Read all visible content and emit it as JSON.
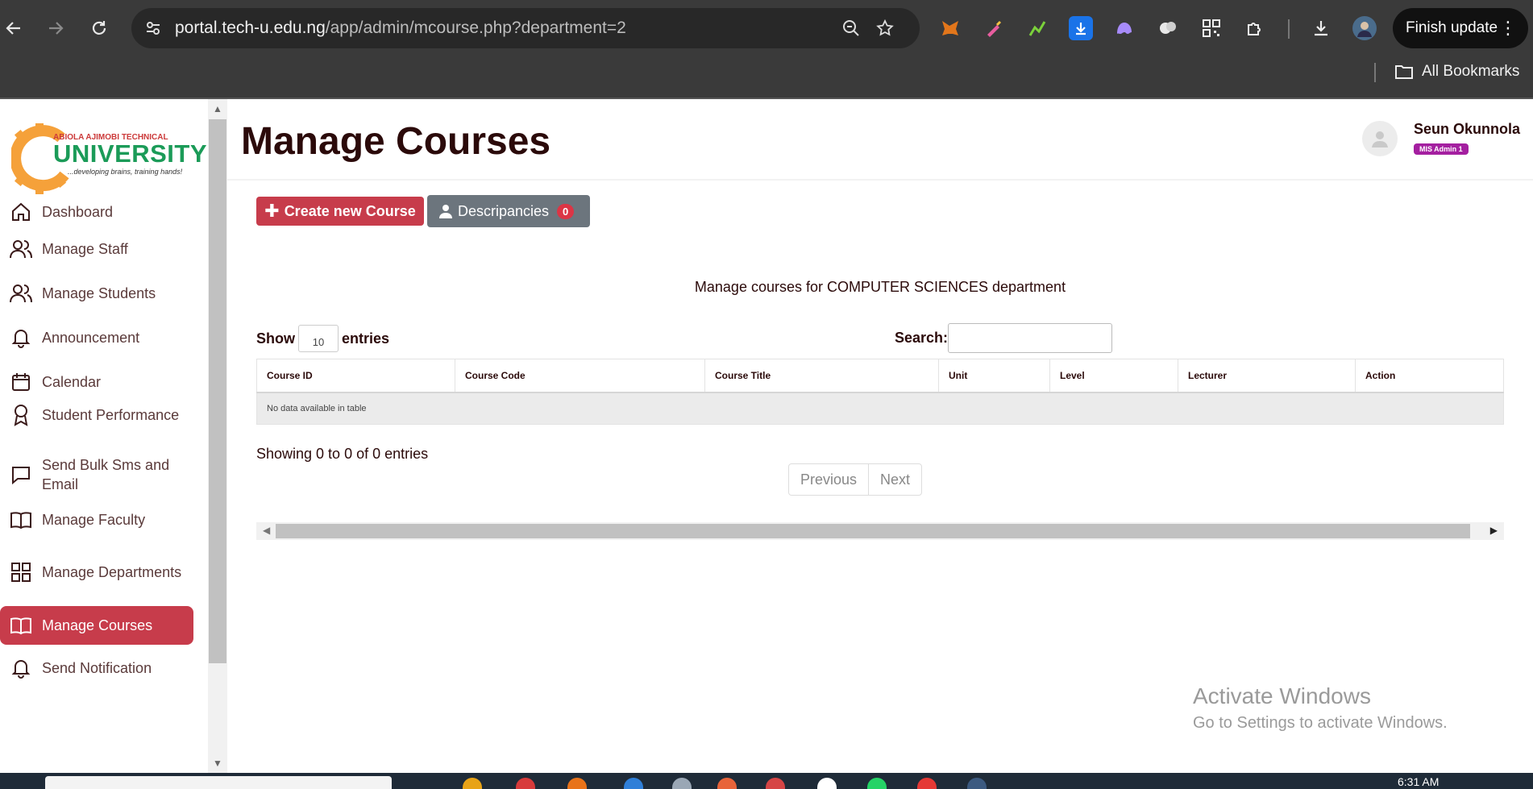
{
  "browser": {
    "url_host": "portal.tech-u.edu.ng",
    "url_path": "/app/admin/mcourse.php?department=2",
    "finish_update_label": "Finish update",
    "bookmarks_label": "All Bookmarks"
  },
  "sidebar": {
    "logo": {
      "top_line": "ABIOLA AJIMOBI TECHNICAL",
      "name": "UNIVERSITY",
      "tagline": "...developing brains, training hands!"
    },
    "items": [
      {
        "label": "Dashboard",
        "icon": "home-icon"
      },
      {
        "label": "Manage Staff",
        "icon": "users-icon"
      },
      {
        "label": "Manage Students",
        "icon": "users-icon"
      },
      {
        "label": "Announcement",
        "icon": "bell-icon"
      },
      {
        "label": "Calendar",
        "icon": "calendar-icon"
      },
      {
        "label": "Student Performance",
        "icon": "award-icon"
      },
      {
        "label": "Send Bulk Sms and Email",
        "icon": "message-icon"
      },
      {
        "label": "Manage Faculty",
        "icon": "book-icon"
      },
      {
        "label": "Manage Departments",
        "icon": "grid-icon"
      },
      {
        "label": "Manage Courses",
        "icon": "book-icon",
        "active": true
      },
      {
        "label": "Send Notification",
        "icon": "bell-icon"
      }
    ]
  },
  "header": {
    "title": "Manage Courses",
    "user_name": "Seun Okunnola",
    "user_role": "MIS Admin 1"
  },
  "actions": {
    "create_label": "Create new Course",
    "discrepancies_label": "Descripancies",
    "discrepancies_count": "0"
  },
  "main": {
    "caption": "Manage courses for COMPUTER SCIENCES department",
    "show_label": "Show",
    "entries_value": "10",
    "entries_label": "entries",
    "search_label": "Search:",
    "search_value": ""
  },
  "table": {
    "columns": [
      "Course ID",
      "Course Code",
      "Course Title",
      "Unit",
      "Level",
      "Lecturer",
      "Action"
    ],
    "empty_message": "No data available in table",
    "info": "Showing 0 to 0 of 0 entries",
    "prev_label": "Previous",
    "next_label": "Next"
  },
  "watermark": {
    "line1": "Activate Windows",
    "line2": "Go to Settings to activate Windows."
  },
  "taskbar": {
    "clock": "6:31 AM"
  },
  "colors": {
    "accent": "#c73c4b",
    "secondary": "#6c757d",
    "role_badge": "#a41fa0",
    "logo_green": "#1b9b58",
    "logo_orange": "#f5a13a"
  }
}
